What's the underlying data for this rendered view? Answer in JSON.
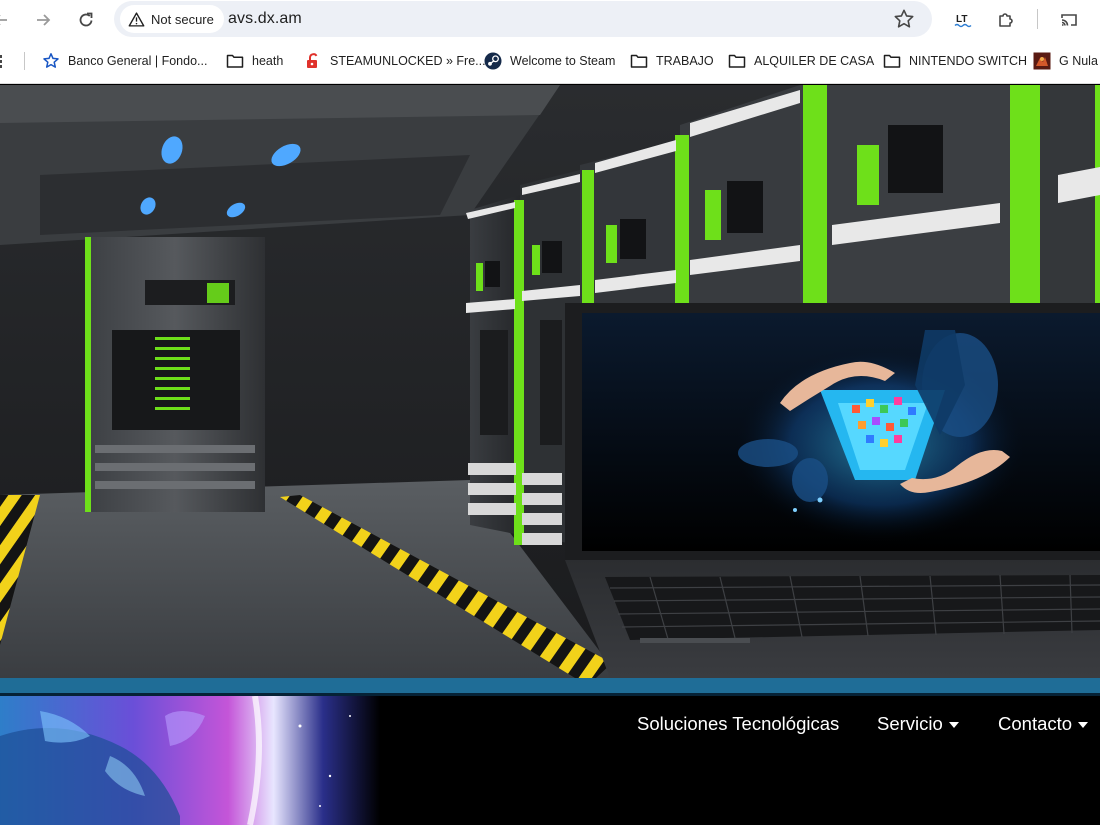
{
  "browser": {
    "security_label": "Not secure",
    "url": "avs.dx.am",
    "icons": [
      "back-icon",
      "forward-icon",
      "reload-icon",
      "warning-icon",
      "star-icon",
      "extension-lt-icon",
      "puzzle-icon",
      "cast-icon"
    ]
  },
  "bookmarks": [
    {
      "label": "Banco General | Fondo...",
      "icon": "star-icon"
    },
    {
      "label": "heath",
      "icon": "folder-icon"
    },
    {
      "label": "STEAMUNLOCKED » Fre...",
      "icon": "padlock-icon"
    },
    {
      "label": "Welcome to Steam",
      "icon": "steam-icon"
    },
    {
      "label": "TRABAJO",
      "icon": "folder-icon"
    },
    {
      "label": "ALQUILER DE CASA",
      "icon": "folder-icon"
    },
    {
      "label": "NINTENDO SWITCH",
      "icon": "folder-icon"
    },
    {
      "label": "G Nula F",
      "icon": "game-icon"
    }
  ],
  "site_nav": {
    "items": [
      {
        "label": "Soluciones Tecnológicas"
      },
      {
        "label": "Servicio"
      },
      {
        "label": "Contacto"
      }
    ]
  },
  "colors": {
    "accent_green": "#6ee01a",
    "strip_blue": "#1f6d97",
    "hazard_yellow": "#f2d21a"
  }
}
